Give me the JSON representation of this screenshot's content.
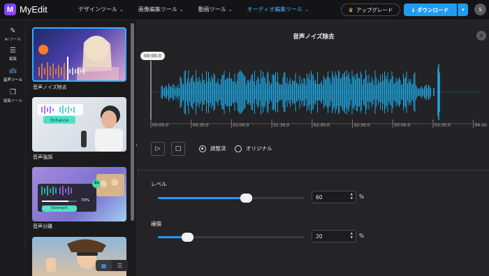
{
  "app": {
    "logo_letter": "M",
    "name": "MyEdit"
  },
  "nav": [
    {
      "label": "デザインツール"
    },
    {
      "label": "画像編集ツール"
    },
    {
      "label": "動画ツール"
    },
    {
      "label": "オーディオ編集ツール",
      "active": true
    }
  ],
  "header": {
    "upgrade_label": "アップグレード",
    "download_label": "ダウンロード",
    "avatar_initial": "S"
  },
  "sidebar": [
    {
      "label": "AI ツール",
      "icon": "magic-wand-icon"
    },
    {
      "label": "編集",
      "icon": "sliders-icon"
    },
    {
      "label": "音声ツール",
      "icon": "waveform-icon",
      "active": true
    },
    {
      "label": "編集ツール",
      "icon": "layers-icon"
    }
  ],
  "library": {
    "cards": [
      {
        "label": "音声ノイズ除去",
        "selected": true,
        "badge": ""
      },
      {
        "label": "音声強調",
        "badge": "Enhance"
      },
      {
        "label": "音声分離",
        "badge": "Strength",
        "percent": "70%",
        "count": "3x"
      },
      {
        "label": ""
      }
    ]
  },
  "editor": {
    "title": "音声ノイズ除去",
    "playhead_time": "00:00.0",
    "timeline_ticks": [
      "00:00.0",
      "00:30.0",
      "01:00.0",
      "01:30.0",
      "02:00.0",
      "02:30.0",
      "03:00.0",
      "03:30.0",
      "04:00"
    ],
    "radio_options": [
      {
        "label": "調整済",
        "selected": true
      },
      {
        "label": "オリジナル",
        "selected": false
      }
    ],
    "level": {
      "label": "レベル",
      "value": "60",
      "unit": "%",
      "fraction": 0.6
    },
    "compensation": {
      "label": "補償",
      "value": "20",
      "unit": "%",
      "fraction": 0.2
    }
  },
  "colors": {
    "accent": "#1f9cf0",
    "active_nav": "#43b6ff",
    "waveform": "#1ea7e0"
  }
}
